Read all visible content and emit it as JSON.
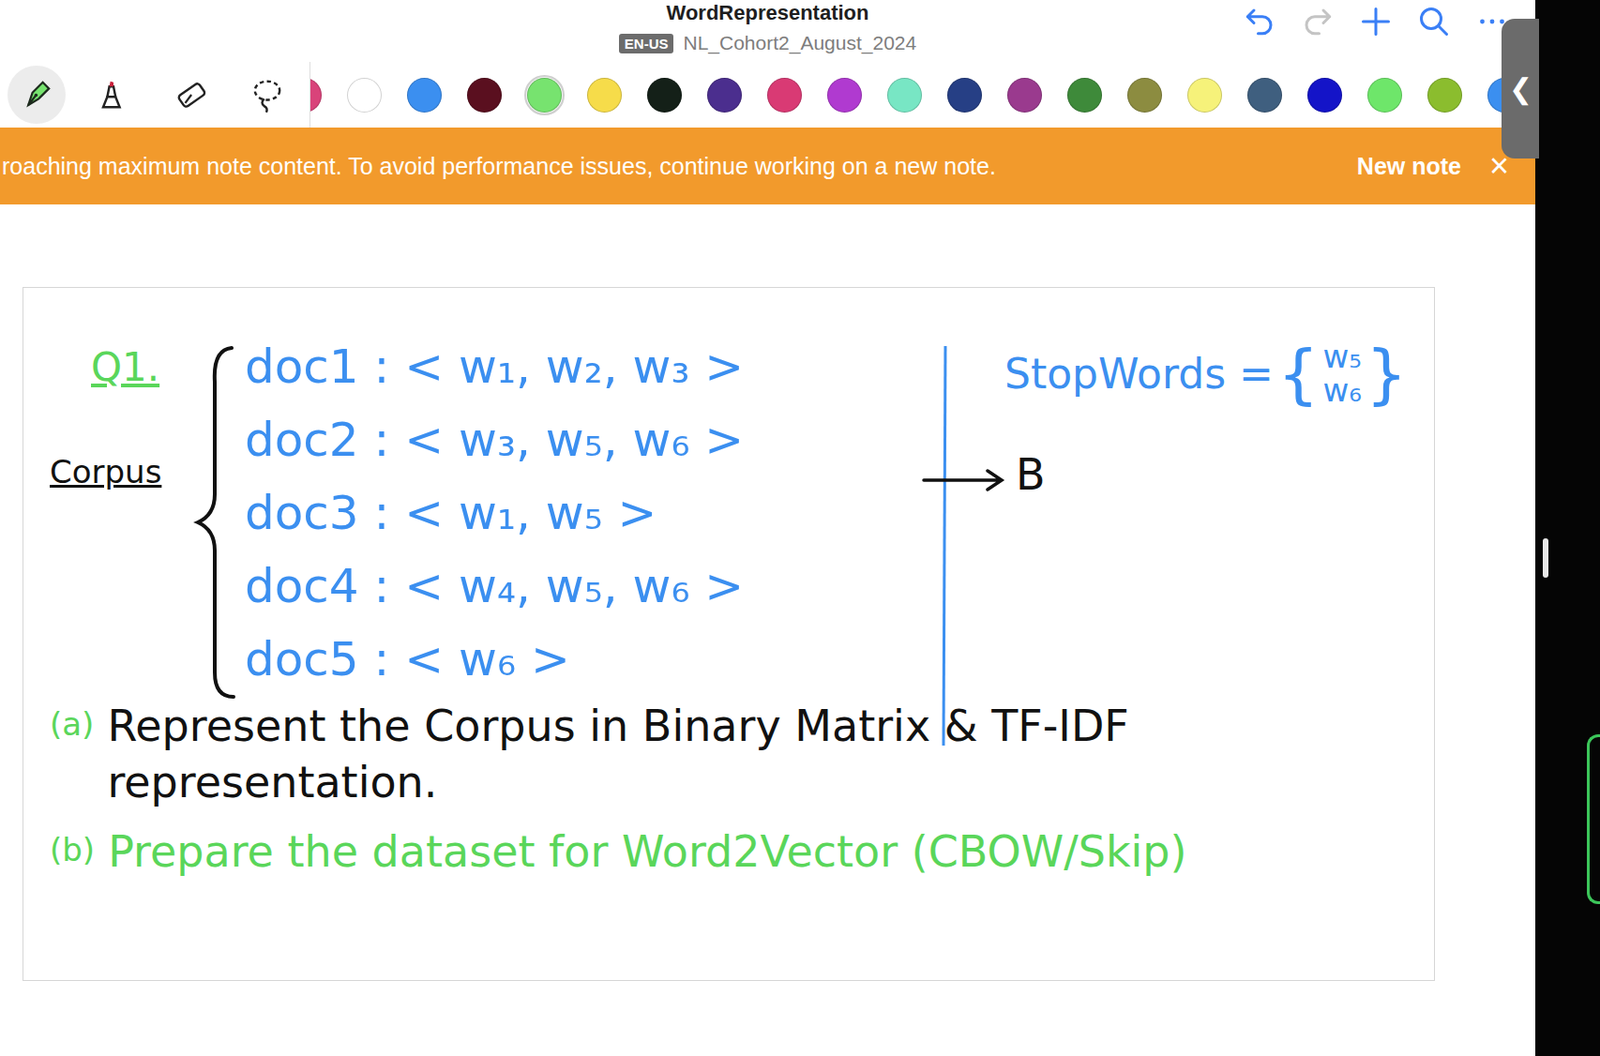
{
  "window": {
    "title": "WordRepresentation",
    "language": "EN-US",
    "notebook": "NL_Cohort2_August_2024"
  },
  "header_actions": [
    {
      "kind": "undo",
      "disabled": false
    },
    {
      "kind": "redo",
      "disabled": true
    },
    {
      "kind": "add",
      "disabled": false
    },
    {
      "kind": "search",
      "disabled": false
    },
    {
      "kind": "more",
      "disabled": false
    }
  ],
  "tools": [
    {
      "kind": "pen",
      "selected": true
    },
    {
      "kind": "highlighter",
      "selected": false
    },
    {
      "kind": "eraser",
      "selected": false
    },
    {
      "kind": "lasso",
      "selected": false
    }
  ],
  "colors": [
    {
      "color": "#d9437a",
      "selected": false
    },
    {
      "color": "#ffffff",
      "selected": false
    },
    {
      "color": "#3b8ff0",
      "selected": false
    },
    {
      "color": "#5a0f1f",
      "selected": false
    },
    {
      "color": "#77e36f",
      "selected": true
    },
    {
      "color": "#f6dc4a",
      "selected": false
    },
    {
      "color": "#142018",
      "selected": false
    },
    {
      "color": "#4b2e8e",
      "selected": false
    },
    {
      "color": "#d93a74",
      "selected": false
    },
    {
      "color": "#b03ad0",
      "selected": false
    },
    {
      "color": "#78e6c4",
      "selected": false
    },
    {
      "color": "#263f85",
      "selected": false
    },
    {
      "color": "#9a3a8e",
      "selected": false
    },
    {
      "color": "#3e8a3a",
      "selected": false
    },
    {
      "color": "#8c8c40",
      "selected": false
    },
    {
      "color": "#f6f27a",
      "selected": false
    },
    {
      "color": "#3f5f7f",
      "selected": false
    },
    {
      "color": "#1414c8",
      "selected": false
    },
    {
      "color": "#6ee66a",
      "selected": false
    },
    {
      "color": "#8bbd2e",
      "selected": false
    },
    {
      "color": "#3b8ff0",
      "selected": false
    }
  ],
  "banner": {
    "message": "roaching maximum note content. To avoid performance issues, continue working on a new note.",
    "action": "New note",
    "close": "×"
  },
  "side_tab": {
    "glyph": "❮"
  },
  "note": {
    "question": {
      "label": "Q1.",
      "color": "#5ad65a"
    },
    "corpus": {
      "label": "Corpus",
      "color": "#111111"
    },
    "docs": [
      {
        "text": "doc1 : < w₁, w₂, w₃ >"
      },
      {
        "text": "doc2 : < w₃, w₅, w₆ >"
      },
      {
        "text": "doc3 : < w₁, w₅ >"
      },
      {
        "text": "doc4 : < w₄, w₅, w₆ >"
      },
      {
        "text": "doc5 : < w₆ >"
      }
    ],
    "docs_color": "#3b8ff0",
    "arrow_label": {
      "text": "B",
      "color": "#111111"
    },
    "stopwords": {
      "label": "StopWords =",
      "open": "{",
      "values": [
        "w₅",
        "w₆"
      ],
      "close": "}",
      "color": "#3b8ff0"
    },
    "tasks": [
      {
        "label": "(a)",
        "label_color": "#5ad65a",
        "text": "Represent the Corpus in Binary Matrix & TF-IDF representation.",
        "color": "#111111"
      },
      {
        "label": "(b)",
        "label_color": "#5ad65a",
        "text": "Prepare the dataset for Word2Vector (CBOW/Skip)",
        "color": "#5ad65a"
      }
    ]
  }
}
